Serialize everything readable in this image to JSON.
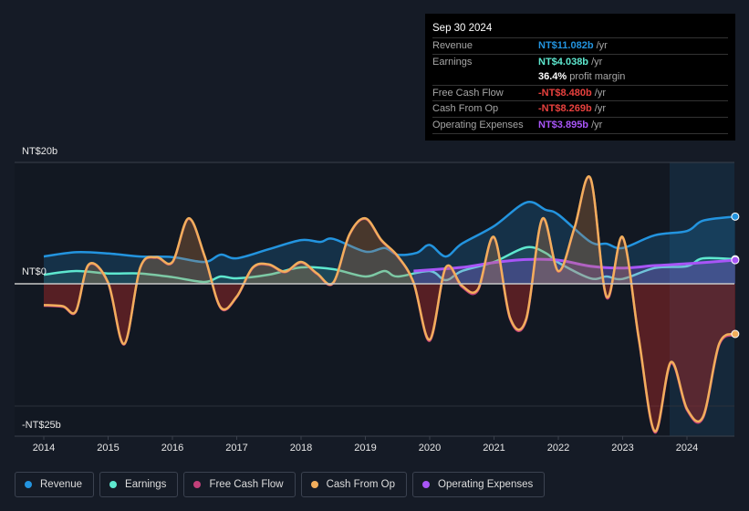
{
  "tooltip": {
    "date": "Sep 30 2024",
    "rows": [
      {
        "label": "Revenue",
        "value": "NT$11.082b",
        "unit": " /yr",
        "color": "#2394df"
      },
      {
        "label": "Earnings",
        "value": "NT$4.038b",
        "unit": " /yr",
        "color": "#5ee8cf"
      },
      {
        "label": "",
        "value": "36.4%",
        "unit": " profit margin",
        "color": "#ffffff"
      },
      {
        "label": "Free Cash Flow",
        "value": "-NT$8.480b",
        "unit": " /yr",
        "color": "#e8413e"
      },
      {
        "label": "Cash From Op",
        "value": "-NT$8.269b",
        "unit": " /yr",
        "color": "#e8413e"
      },
      {
        "label": "Operating Expenses",
        "value": "NT$3.895b",
        "unit": " /yr",
        "color": "#a855f7"
      }
    ]
  },
  "legend": [
    {
      "label": "Revenue",
      "color": "#2394df"
    },
    {
      "label": "Earnings",
      "color": "#5ee8cf"
    },
    {
      "label": "Free Cash Flow",
      "color": "#c2407a"
    },
    {
      "label": "Cash From Op",
      "color": "#f2ae5c"
    },
    {
      "label": "Operating Expenses",
      "color": "#a855f7"
    }
  ],
  "chart_data": {
    "type": "line",
    "ylim": [
      -25,
      20
    ],
    "y_ticks": [
      {
        "value": 20,
        "label": "NT$20b"
      },
      {
        "value": 0,
        "label": "NT$0"
      },
      {
        "value": -25,
        "label": "-NT$25b"
      }
    ],
    "x_ticks": [
      "2014",
      "2015",
      "2016",
      "2017",
      "2018",
      "2019",
      "2020",
      "2021",
      "2022",
      "2023",
      "2024"
    ],
    "xlim": [
      2014,
      2024.75
    ],
    "series": [
      {
        "name": "Revenue",
        "color": "#2394df",
        "points": [
          [
            2014,
            4.5
          ],
          [
            2014.5,
            5.2
          ],
          [
            2015,
            5
          ],
          [
            2015.5,
            4.5
          ],
          [
            2016,
            4.4
          ],
          [
            2016.5,
            3.6
          ],
          [
            2016.75,
            4.8
          ],
          [
            2017,
            4.2
          ],
          [
            2017.5,
            5.7
          ],
          [
            2018,
            7.2
          ],
          [
            2018.3,
            6.9
          ],
          [
            2018.5,
            7.4
          ],
          [
            2019,
            5.3
          ],
          [
            2019.3,
            5.9
          ],
          [
            2019.5,
            4.8
          ],
          [
            2019.8,
            5.1
          ],
          [
            2020,
            6.4
          ],
          [
            2020.25,
            4.5
          ],
          [
            2020.5,
            6.6
          ],
          [
            2021,
            9.5
          ],
          [
            2021.5,
            13.4
          ],
          [
            2021.8,
            12.2
          ],
          [
            2022,
            11.4
          ],
          [
            2022.5,
            6.9
          ],
          [
            2022.75,
            6.6
          ],
          [
            2023,
            5.9
          ],
          [
            2023.5,
            8.0
          ],
          [
            2024,
            8.7
          ],
          [
            2024.25,
            10.4
          ],
          [
            2024.75,
            11.08
          ]
        ]
      },
      {
        "name": "Earnings",
        "color": "#5ee8cf",
        "points": [
          [
            2014,
            1.5
          ],
          [
            2014.5,
            2.1
          ],
          [
            2015,
            1.7
          ],
          [
            2015.5,
            1.7
          ],
          [
            2016,
            1.1
          ],
          [
            2016.5,
            0.3
          ],
          [
            2016.75,
            1.2
          ],
          [
            2017,
            0.9
          ],
          [
            2017.5,
            1.5
          ],
          [
            2018,
            2.7
          ],
          [
            2018.5,
            2.4
          ],
          [
            2019,
            1.2
          ],
          [
            2019.3,
            2.1
          ],
          [
            2019.5,
            1.2
          ],
          [
            2020,
            2.1
          ],
          [
            2020.25,
            0.6
          ],
          [
            2020.5,
            2.1
          ],
          [
            2021,
            3.6
          ],
          [
            2021.5,
            6.0
          ],
          [
            2021.8,
            5.1
          ],
          [
            2022,
            3.5
          ],
          [
            2022.5,
            0.9
          ],
          [
            2022.75,
            1.2
          ],
          [
            2023,
            0.8
          ],
          [
            2023.5,
            2.6
          ],
          [
            2024,
            2.9
          ],
          [
            2024.25,
            4.2
          ],
          [
            2024.75,
            4.04
          ]
        ]
      },
      {
        "name": "Free Cash Flow",
        "color": "#c2407a",
        "points": [
          [
            2014,
            -3.6
          ],
          [
            2014.3,
            -3.8
          ],
          [
            2014.5,
            -4.6
          ],
          [
            2014.7,
            3.1
          ],
          [
            2015,
            0.1
          ],
          [
            2015.25,
            -10
          ],
          [
            2015.5,
            2.6
          ],
          [
            2015.75,
            4.3
          ],
          [
            2016,
            3.5
          ],
          [
            2016.25,
            10.7
          ],
          [
            2016.5,
            4.5
          ],
          [
            2016.75,
            -4
          ],
          [
            2017,
            -2.2
          ],
          [
            2017.25,
            2.6
          ],
          [
            2017.5,
            3.1
          ],
          [
            2017.75,
            1.9
          ],
          [
            2018,
            3.5
          ],
          [
            2018.25,
            1.6
          ],
          [
            2018.5,
            0.1
          ],
          [
            2018.75,
            8
          ],
          [
            2019,
            10.7
          ],
          [
            2019.25,
            7.1
          ],
          [
            2019.5,
            4.5
          ],
          [
            2019.75,
            0.1
          ],
          [
            2020,
            -9.4
          ],
          [
            2020.25,
            2.6
          ],
          [
            2020.5,
            -0.5
          ],
          [
            2020.75,
            -1.1
          ],
          [
            2021,
            7.6
          ],
          [
            2021.25,
            -5.8
          ],
          [
            2021.5,
            -6
          ],
          [
            2021.75,
            10.6
          ],
          [
            2022,
            2
          ],
          [
            2022.25,
            9.1
          ],
          [
            2022.5,
            17.3
          ],
          [
            2022.75,
            -2.3
          ],
          [
            2023,
            7.6
          ],
          [
            2023.25,
            -9.1
          ],
          [
            2023.5,
            -24.5
          ],
          [
            2023.75,
            -13.1
          ],
          [
            2024,
            -20.8
          ],
          [
            2024.25,
            -22.1
          ],
          [
            2024.5,
            -10.1
          ],
          [
            2024.75,
            -8.48
          ]
        ]
      },
      {
        "name": "Cash From Op",
        "color": "#f2ae5c",
        "points": [
          [
            2014,
            -3.5
          ],
          [
            2014.3,
            -3.7
          ],
          [
            2014.5,
            -4.5
          ],
          [
            2014.7,
            3.2
          ],
          [
            2015,
            0.2
          ],
          [
            2015.25,
            -9.9
          ],
          [
            2015.5,
            2.7
          ],
          [
            2015.75,
            4.4
          ],
          [
            2016,
            3.6
          ],
          [
            2016.25,
            10.8
          ],
          [
            2016.5,
            4.6
          ],
          [
            2016.75,
            -3.9
          ],
          [
            2017,
            -2.1
          ],
          [
            2017.25,
            2.7
          ],
          [
            2017.5,
            3.2
          ],
          [
            2017.75,
            2.0
          ],
          [
            2018,
            3.6
          ],
          [
            2018.25,
            1.7
          ],
          [
            2018.5,
            0.2
          ],
          [
            2018.75,
            8.1
          ],
          [
            2019,
            10.8
          ],
          [
            2019.25,
            7.2
          ],
          [
            2019.5,
            4.6
          ],
          [
            2019.75,
            0.2
          ],
          [
            2020,
            -9.2
          ],
          [
            2020.25,
            2.7
          ],
          [
            2020.5,
            -0.3
          ],
          [
            2020.75,
            -0.9
          ],
          [
            2021,
            7.7
          ],
          [
            2021.25,
            -5.6
          ],
          [
            2021.5,
            -5.8
          ],
          [
            2021.75,
            10.7
          ],
          [
            2022,
            2.1
          ],
          [
            2022.25,
            9.2
          ],
          [
            2022.5,
            17.4
          ],
          [
            2022.75,
            -2.1
          ],
          [
            2023,
            7.7
          ],
          [
            2023.25,
            -8.9
          ],
          [
            2023.5,
            -24.3
          ],
          [
            2023.75,
            -12.9
          ],
          [
            2024,
            -20.6
          ],
          [
            2024.25,
            -21.9
          ],
          [
            2024.5,
            -9.9
          ],
          [
            2024.75,
            -8.27
          ]
        ]
      },
      {
        "name": "Operating Expenses",
        "color": "#a855f7",
        "points": [
          [
            2019.75,
            2.1
          ],
          [
            2020.5,
            2.7
          ],
          [
            2021,
            3.5
          ],
          [
            2021.5,
            4.0
          ],
          [
            2022,
            3.9
          ],
          [
            2022.5,
            2.9
          ],
          [
            2023,
            2.6
          ],
          [
            2023.5,
            3.0
          ],
          [
            2024,
            3.3
          ],
          [
            2024.75,
            3.9
          ]
        ]
      }
    ]
  }
}
